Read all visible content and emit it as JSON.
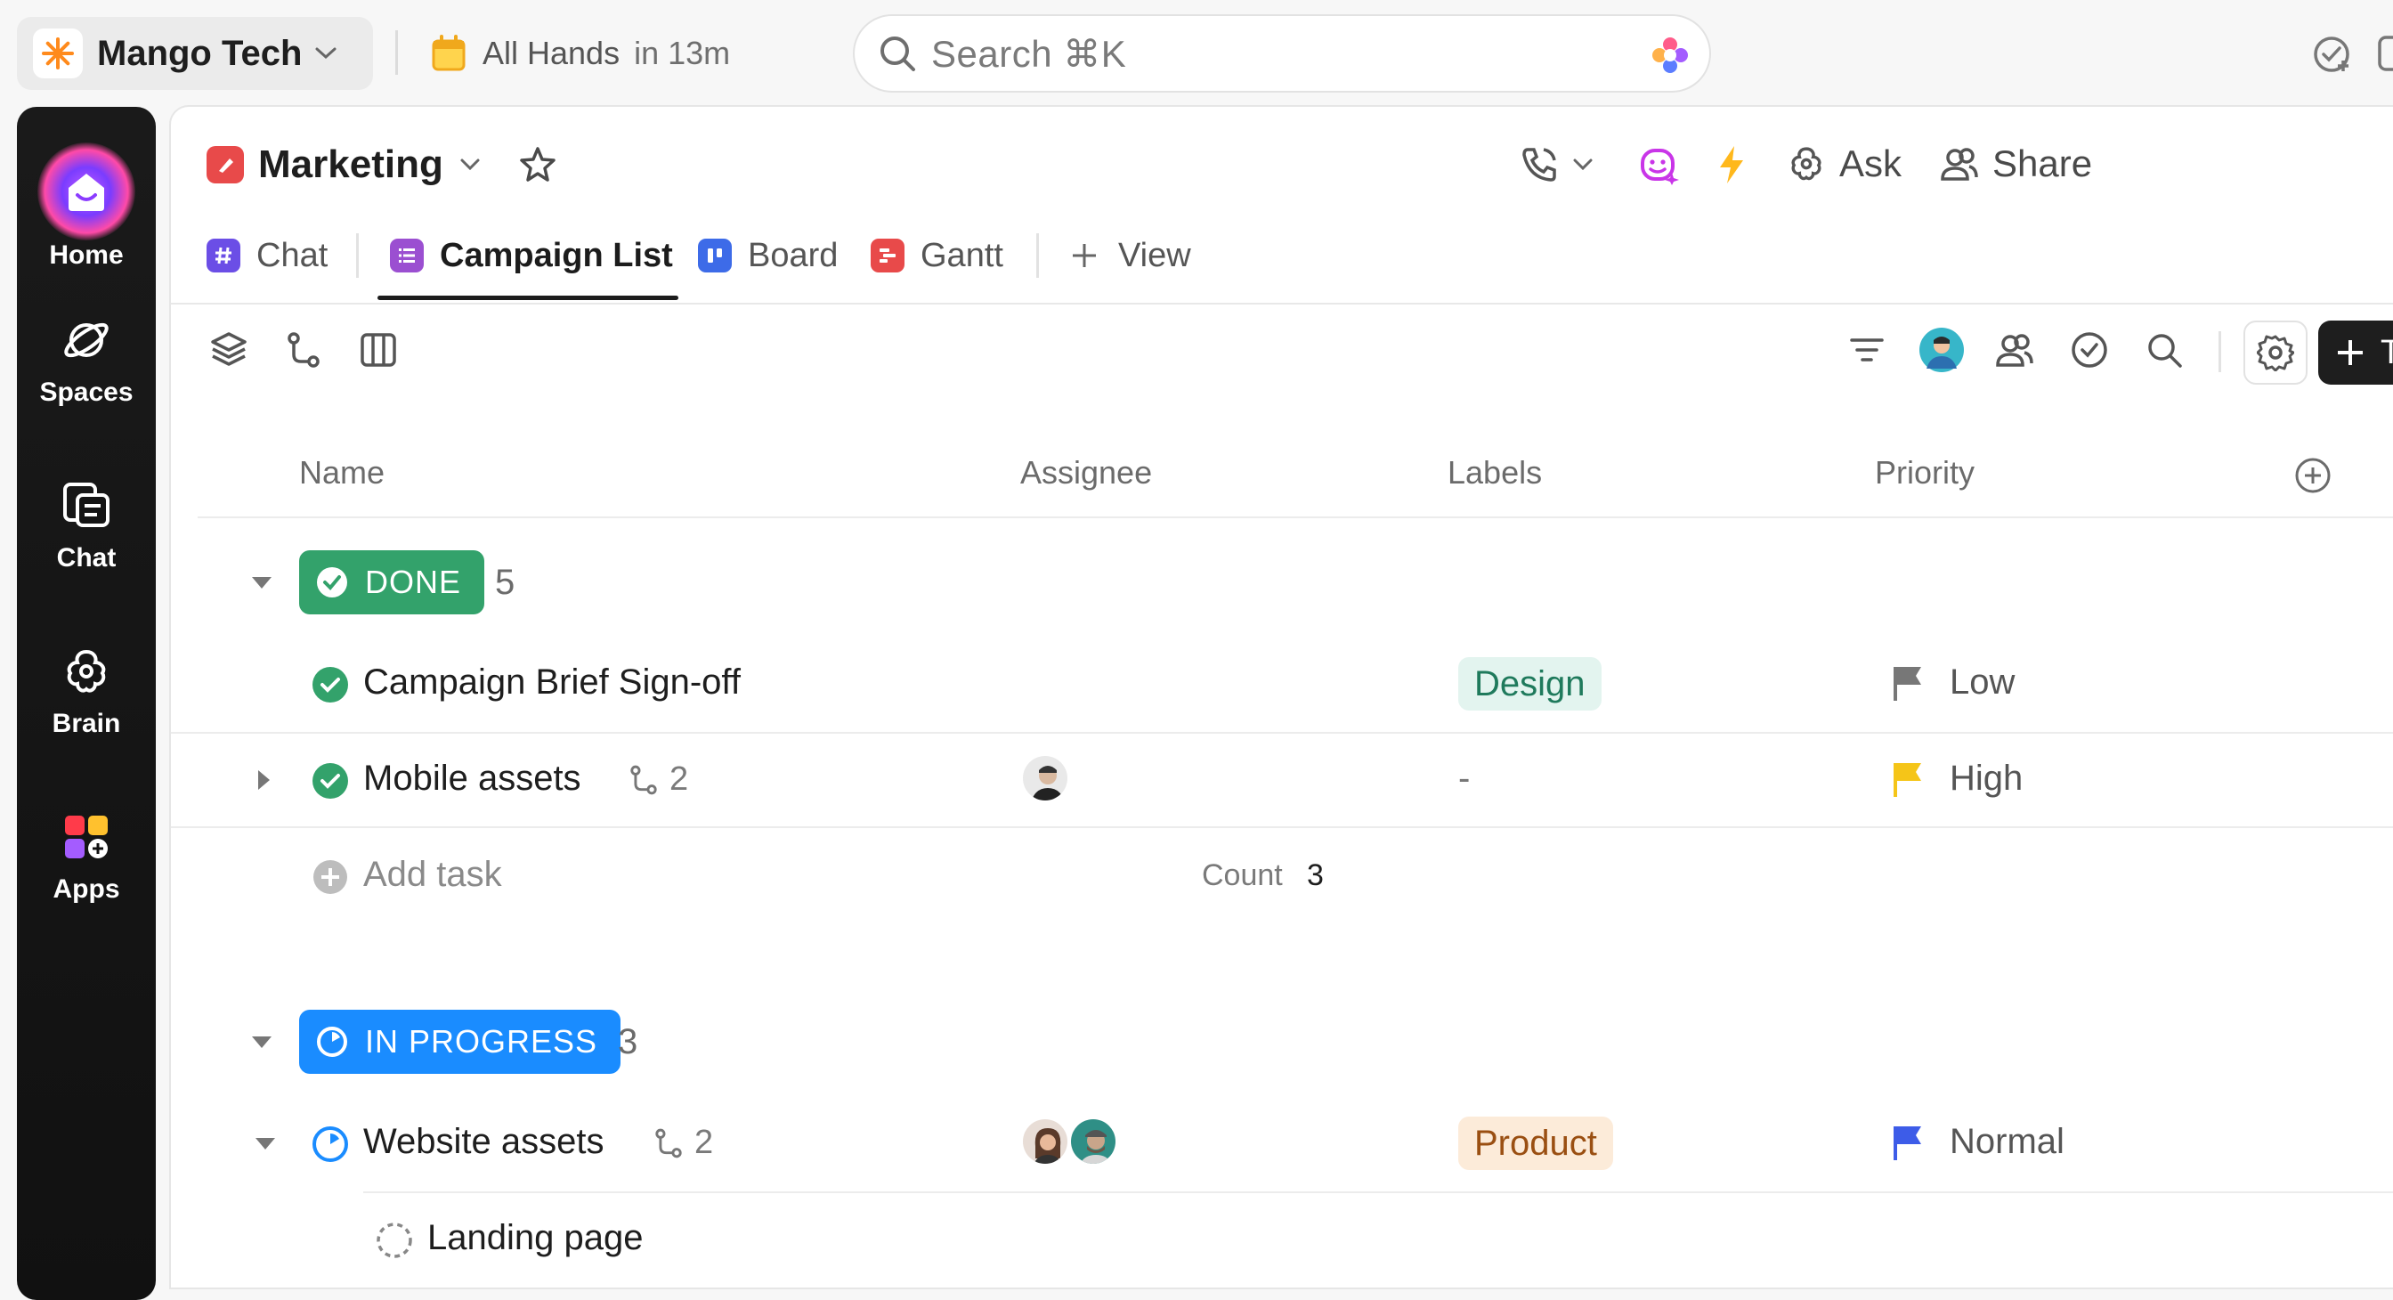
{
  "topbar": {
    "workspace_name": "Mango Tech",
    "event_title": "All Hands",
    "event_time": "in 13m",
    "search_placeholder": "Search ⌘K"
  },
  "rail": {
    "items": [
      {
        "label": "Home",
        "icon": "home-icon"
      },
      {
        "label": "Spaces",
        "icon": "planet-icon"
      },
      {
        "label": "Chat",
        "icon": "chat-icon"
      },
      {
        "label": "Brain",
        "icon": "brain-icon"
      },
      {
        "label": "Apps",
        "icon": "apps-icon"
      }
    ]
  },
  "header": {
    "list_name": "Marketing",
    "ask_label": "Ask",
    "share_label": "Share"
  },
  "tabs": [
    {
      "label": "Chat",
      "color": "#6b4ee6",
      "active": false
    },
    {
      "label": "Campaign List",
      "color": "#9b4fd1",
      "active": true
    },
    {
      "label": "Board",
      "color": "#3d6be8",
      "active": false
    },
    {
      "label": "Gantt",
      "color": "#e84a4a",
      "active": false
    },
    {
      "label": "View",
      "active": false
    }
  ],
  "toolbar": {
    "add_task_label": "T"
  },
  "columns": [
    "Name",
    "Assignee",
    "Labels",
    "Priority"
  ],
  "groups": [
    {
      "status": "DONE",
      "count": "5",
      "color": "#33a26b",
      "tasks": [
        {
          "name": "Campaign Brief Sign-off",
          "label": "Design",
          "label_bg": "#e3f4ef",
          "label_color": "#1f7a5c",
          "priority": "Low",
          "priority_color": "#777777"
        },
        {
          "name": "Mobile assets",
          "subtasks": "2",
          "label": "-",
          "priority": "High",
          "priority_color": "#f5c518"
        }
      ],
      "add_task": "Add task",
      "count_label": "Count",
      "count_value": "3"
    },
    {
      "status": "IN PROGRESS",
      "count": "3",
      "color": "#1a8cff",
      "tasks": [
        {
          "name": "Website assets",
          "subtasks": "2",
          "label": "Product",
          "label_bg": "#fcebd9",
          "label_color": "#9a4f12",
          "priority": "Normal",
          "priority_color": "#3d5ce8"
        },
        {
          "name": "Landing page"
        }
      ]
    }
  ]
}
